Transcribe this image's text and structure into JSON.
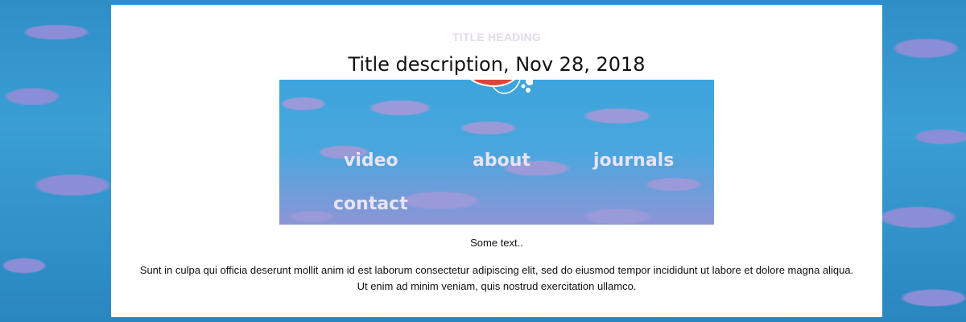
{
  "page": {
    "title_heading": "TITLE HEADING",
    "title_description": "Title description, Nov 28, 2018"
  },
  "banner": {
    "icon": "life-ring-float-icon",
    "nav": [
      {
        "label": "video"
      },
      {
        "label": "about"
      },
      {
        "label": "journals"
      },
      {
        "label": "contact"
      }
    ]
  },
  "content": {
    "intro": "Some text..",
    "paragraph": "Sunt in culpa qui officia deserunt mollit anim id est laborum consectetur adipiscing elit, sed do eiusmod tempor incididunt ut labore et dolore magna aliqua. Ut enim ad minim veniam, quis nostrud exercitation ullamco."
  },
  "colors": {
    "heading": "#e6d9ec",
    "nav_text": "#e8e4f6",
    "water": "#3ca4dc",
    "wave": "#9b9ad8",
    "float_red": "#e0453a"
  }
}
